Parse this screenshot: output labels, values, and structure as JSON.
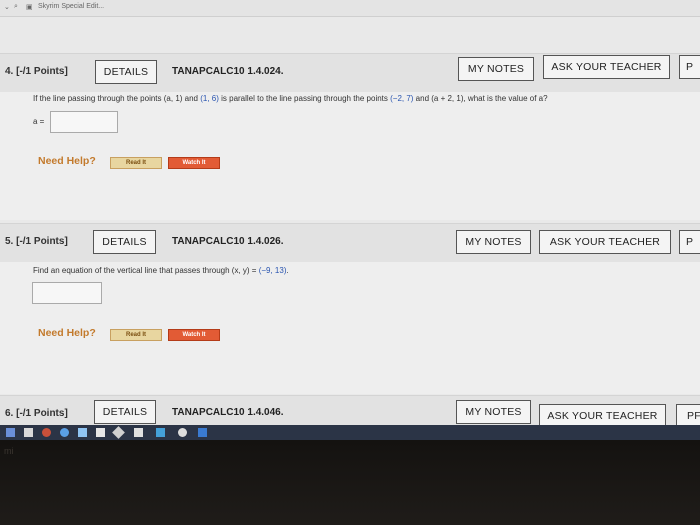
{
  "browser": {
    "tab_text": "Skyrim Special Edit..."
  },
  "questions": [
    {
      "number": "4. [-/1 Points]",
      "details": "DETAILS",
      "code": "TANAPCALC10 1.4.024.",
      "my_notes": "MY NOTES",
      "ask_teacher": "ASK YOUR TEACHER",
      "extra_btn": "P",
      "text_parts": {
        "a": "If the line passing through the points (a, 1) and ",
        "b": "(1, 6)",
        "c": " is parallel to the line passing through the points ",
        "d": "(−2, 7)",
        "e": " and (a + 2, 1), what is the value of a?"
      },
      "answer_label": "a =",
      "need_help": "Need Help?",
      "read_it": "Read It",
      "watch_it": "Watch It"
    },
    {
      "number": "5. [-/1 Points]",
      "details": "DETAILS",
      "code": "TANAPCALC10 1.4.026.",
      "my_notes": "MY NOTES",
      "ask_teacher": "ASK YOUR TEACHER",
      "extra_btn": "P",
      "text_parts": {
        "a": "Find an equation of the vertical line that passes through (x, y) = ",
        "b": "(−9, 13)",
        "c": "."
      },
      "need_help": "Need Help?",
      "read_it": "Read It",
      "watch_it": "Watch It"
    },
    {
      "number": "6. [-/1 Points]",
      "details": "DETAILS",
      "code": "TANAPCALC10 1.4.046.",
      "my_notes": "MY NOTES",
      "ask_teacher": "ASK YOUR TEACHER",
      "extra_btn": "PF"
    }
  ],
  "bezel_text": "mi"
}
